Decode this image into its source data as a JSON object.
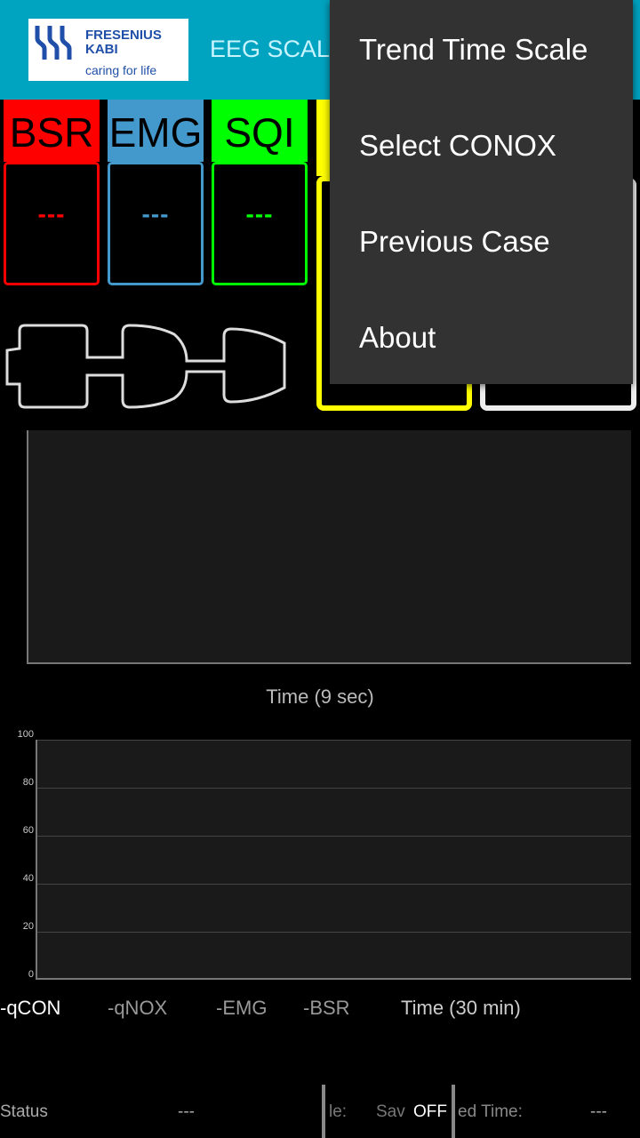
{
  "header": {
    "logo": {
      "brand_line1": "FRESENIUS",
      "brand_line2": "KABI",
      "tagline": "caring for life"
    },
    "title": "EEG SCAL",
    "background": "#00a3c0"
  },
  "tiles": [
    {
      "label": "BSR",
      "value": "---",
      "color": "#ff0000"
    },
    {
      "label": "EMG",
      "value": "---",
      "color": "#4499cc"
    },
    {
      "label": "SQI",
      "value": "---",
      "color": "#00ff00"
    }
  ],
  "index_tiles": [
    {
      "color": "#ffff00"
    },
    {
      "color": "#eeeeee"
    }
  ],
  "menu": {
    "items": [
      "Trend Time Scale",
      "Select CONOX",
      "Previous Case",
      "About"
    ]
  },
  "eeg_graph": {
    "xlabel": "Time (9 sec)"
  },
  "trend_graph": {
    "y_ticks": [
      "100",
      "80",
      "60",
      "40",
      "20",
      "0"
    ],
    "ylim": [
      0,
      100
    ],
    "grid": true,
    "legend": [
      "-qCON",
      "-qNOX",
      "-EMG",
      "-BSR"
    ],
    "xlabel": "Time (30 min)"
  },
  "status_bar": {
    "status_label": "Status",
    "status_value": "---",
    "file_label": "le:",
    "save_label": "Sav",
    "save_value": "OFF",
    "elapsed_label": "ed Time:",
    "elapsed_value": "---"
  }
}
